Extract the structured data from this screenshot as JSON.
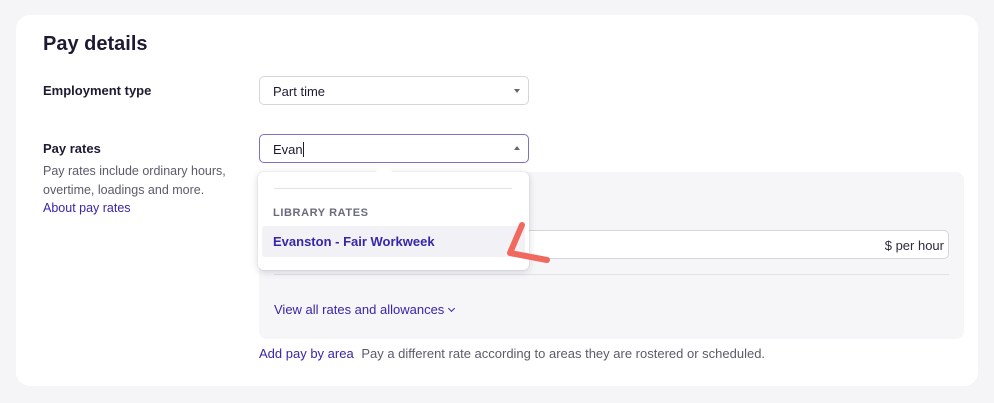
{
  "page": {
    "title": "Pay details"
  },
  "employment_type": {
    "label": "Employment type",
    "value": "Part time"
  },
  "pay_rates": {
    "label": "Pay rates",
    "help_text": "Pay rates include ordinary hours, overtime, loadings and more.",
    "help_link": "About pay rates",
    "search_value": "Evan",
    "unit": "$ per hour",
    "view_all": "View all rates and allowances"
  },
  "dropdown": {
    "group_label": "LIBRARY RATES",
    "options": [
      {
        "label": "Evanston - Fair Workweek"
      }
    ]
  },
  "add_pay": {
    "link": "Add pay by area",
    "description": "Pay a different rate according to areas they are rostered or scheduled."
  },
  "colors": {
    "accent": "#3826a8",
    "annotation": "#f0685e"
  }
}
